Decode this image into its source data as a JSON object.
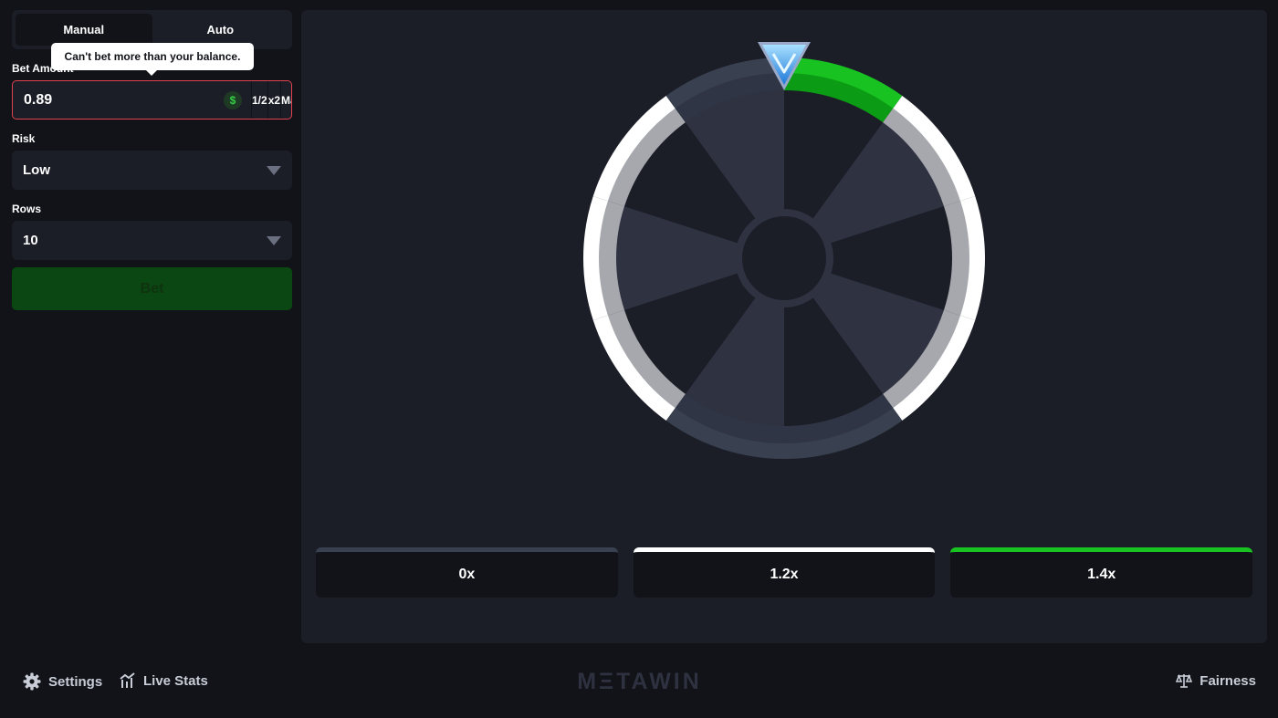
{
  "mode_tabs": {
    "manual": "Manual",
    "auto": "Auto"
  },
  "tooltip": "Can't bet more than your balance.",
  "bet": {
    "label": "Bet Amount",
    "value": "0.89",
    "currency_symbol": "$",
    "half_label": "1/2",
    "double_label": "x2",
    "max_label": "Max"
  },
  "risk": {
    "label": "Risk",
    "value": "Low"
  },
  "rows": {
    "label": "Rows",
    "value": "10"
  },
  "bet_button": "Bet",
  "multipliers": [
    {
      "label": "0x",
      "color": "#394050"
    },
    {
      "label": "1.2x",
      "color": "#ffffff"
    },
    {
      "label": "1.4x",
      "color": "#17c221"
    }
  ],
  "wheel": {
    "segment_count": 10,
    "segments": [
      "1.4x",
      "1.2x",
      "1.2x",
      "1.2x",
      "0x",
      "0x",
      "1.2x",
      "1.2x",
      "1.2x",
      "0x"
    ]
  },
  "footer": {
    "settings": "Settings",
    "live_stats": "Live Stats",
    "brand": "MΞTAWIN",
    "fairness": "Fairness"
  },
  "colors": {
    "accent_green": "#17c221",
    "error_border": "#e0414f",
    "panel": "#1b1e27",
    "background": "#111318"
  }
}
